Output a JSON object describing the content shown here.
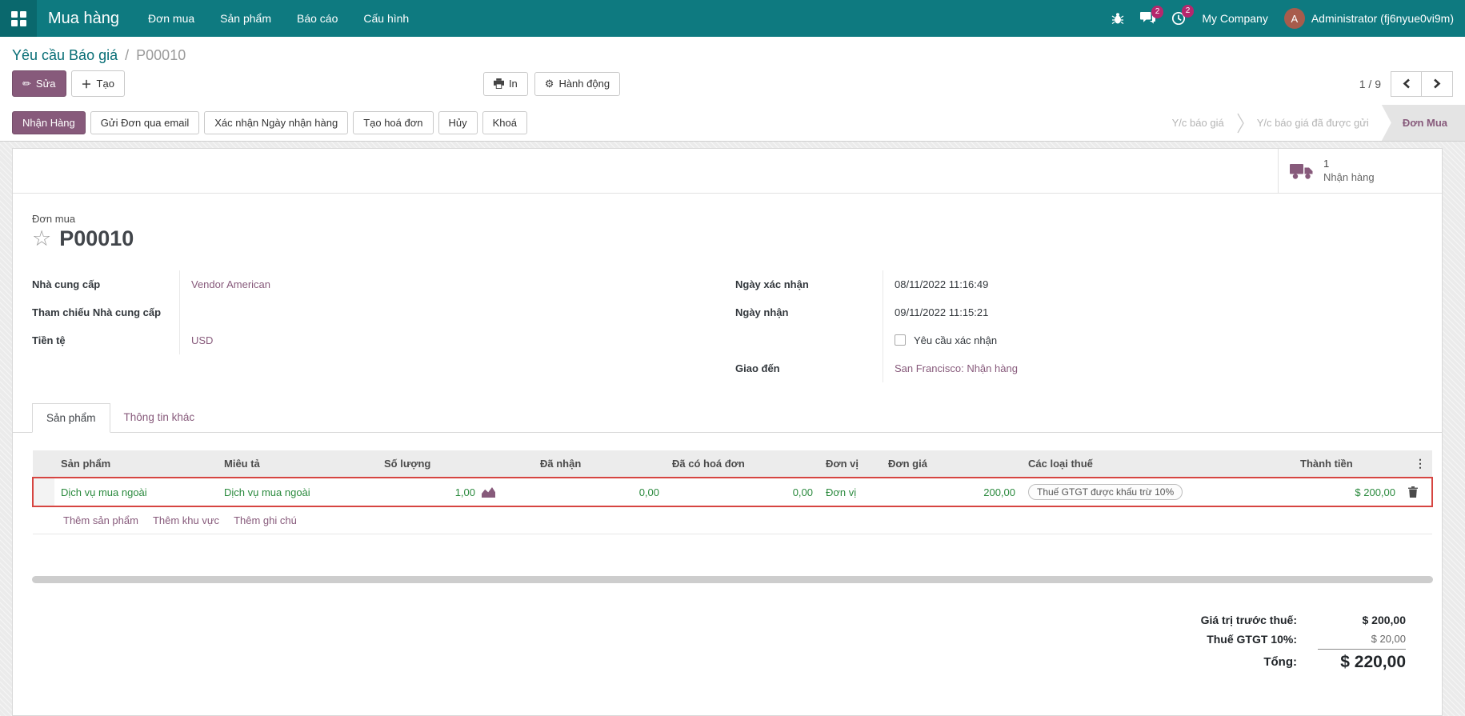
{
  "colors": {
    "navbar_bg": "#0e7a80",
    "navbar_bg_dark": "#0a686d",
    "primary": "#875a7b",
    "link": "#875a7b",
    "teal_link": "#066d75",
    "row_green": "#2b8a3e",
    "highlight_red": "#d64541",
    "badge": "#b5276d",
    "avatar_bg": "#a85c4c"
  },
  "navbar": {
    "brand": "Mua hàng",
    "menus": [
      "Đơn mua",
      "Sản phẩm",
      "Báo cáo",
      "Cấu hình"
    ],
    "icons": [
      "apps-grid",
      "bug",
      "messages-bubble",
      "activity-clock"
    ],
    "messages_badge": "2",
    "activity_badge": "2",
    "company": "My Company",
    "avatar_letter": "A",
    "user": "Administrator (fj6nyue0vi9m)"
  },
  "breadcrumb": {
    "parent": "Yêu cầu Báo giá",
    "separator": "/",
    "current": "P00010"
  },
  "control_panel": {
    "edit": "Sửa",
    "create": "Tạo",
    "print": "In",
    "action": "Hành động",
    "pager": "1 / 9"
  },
  "statusbar": {
    "buttons": [
      {
        "label": "Nhận Hàng",
        "primary": true
      },
      {
        "label": "Gửi Đơn qua email",
        "primary": false
      },
      {
        "label": "Xác nhận Ngày nhận hàng",
        "primary": false
      },
      {
        "label": "Tạo hoá đơn",
        "primary": false
      },
      {
        "label": "Hủy",
        "primary": false
      },
      {
        "label": "Khoá",
        "primary": false
      }
    ],
    "states": [
      {
        "label": "Y/c báo giá",
        "active": false
      },
      {
        "label": "Y/c báo giá đã được gửi",
        "active": false
      },
      {
        "label": "Đơn Mua",
        "active": true
      }
    ]
  },
  "smart_button": {
    "count": "1",
    "label": "Nhận hàng",
    "icon": "truck"
  },
  "form": {
    "type_label": "Đơn mua",
    "name": "P00010",
    "star_icon": "star-outline",
    "fields_left": [
      {
        "label": "Nhà cung cấp",
        "value": "Vendor American"
      },
      {
        "label": "Tham chiếu Nhà cung cấp",
        "value": ""
      },
      {
        "label": "Tiền tệ",
        "value": "USD"
      }
    ],
    "fields_right": [
      {
        "label": "Ngày xác nhận",
        "value": "08/11/2022 11:16:49"
      },
      {
        "label": "Ngày nhận",
        "value": "09/11/2022 11:15:21"
      },
      {
        "label": "",
        "checkbox_label": "Yêu cầu xác nhận",
        "checked": false
      },
      {
        "label": "Giao đến",
        "value": "San Francisco: Nhận hàng"
      }
    ]
  },
  "tabs": [
    {
      "label": "Sản phẩm",
      "active": true
    },
    {
      "label": "Thông tin khác",
      "active": false
    }
  ],
  "table": {
    "headers": {
      "product": "Sản phẩm",
      "description": "Miêu tả",
      "quantity": "Số lượng",
      "received": "Đã nhận",
      "billed": "Đã có hoá đơn",
      "uom": "Đơn vị",
      "unit_price": "Đơn giá",
      "taxes": "Các loại thuế",
      "subtotal": "Thành tiền",
      "kebab": "⋮"
    },
    "row": {
      "product": "Dịch vụ mua ngoài",
      "description": "Dịch vụ mua ngoài",
      "quantity": "1,00",
      "forecast_icon": "area-chart",
      "received": "0,00",
      "billed": "0,00",
      "uom": "Đơn vị",
      "unit_price": "200,00",
      "tax": "Thuế GTGT được khấu trừ 10%",
      "subtotal": "$ 200,00",
      "delete_icon": "trash"
    },
    "footer_links": [
      "Thêm sản phẩm",
      "Thêm khu vực",
      "Thêm ghi chú"
    ]
  },
  "totals": {
    "untaxed": {
      "label": "Giá trị trước thuế:",
      "value": "$ 200,00"
    },
    "tax": {
      "label": "Thuế GTGT 10%:",
      "value": "$ 20,00"
    },
    "total": {
      "label": "Tổng:",
      "value": "$ 220,00"
    }
  }
}
